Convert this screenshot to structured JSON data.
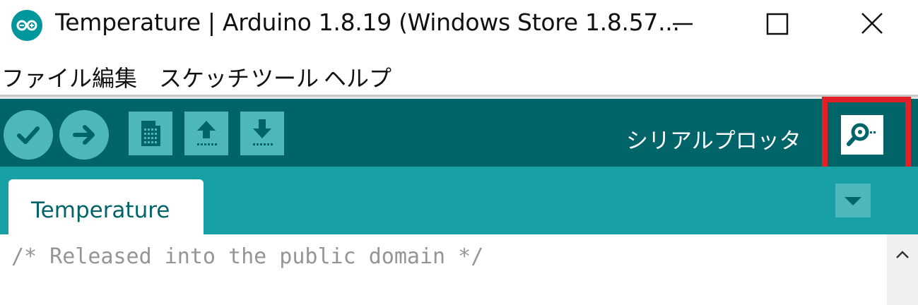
{
  "window": {
    "title": "Temperature | Arduino 1.8.19 (Windows Store 1.8.57...",
    "app_icon": "arduino-logo-icon",
    "controls": [
      "minimize-icon",
      "maximize-icon",
      "close-icon"
    ]
  },
  "menu": {
    "items": [
      {
        "label": "ファイル"
      },
      {
        "label": "編集"
      },
      {
        "label": "スケッチ"
      },
      {
        "label": "ツール"
      },
      {
        "label": "ヘルプ"
      }
    ]
  },
  "toolbar": {
    "buttons": [
      {
        "icon": "verify-check-icon"
      },
      {
        "icon": "upload-arrow-icon"
      },
      {
        "icon": "new-sketch-icon"
      },
      {
        "icon": "open-sketch-icon"
      },
      {
        "icon": "save-sketch-icon"
      }
    ],
    "hover_label": "シリアルプロッタ",
    "serial_button_icon": "serial-monitor-icon",
    "highlight_color": "#e32027"
  },
  "tabs": {
    "items": [
      {
        "label": "Temperature",
        "active": true
      }
    ],
    "menu_icon": "tab-menu-down-icon"
  },
  "editor": {
    "lines": [
      "/* Released into the public domain */"
    ]
  },
  "colors": {
    "toolbar_bg": "#006468",
    "tabbar_bg": "#17a1a5",
    "button_bg": "#4db7bb",
    "tab_text": "#006468",
    "comment_text": "#959595"
  }
}
